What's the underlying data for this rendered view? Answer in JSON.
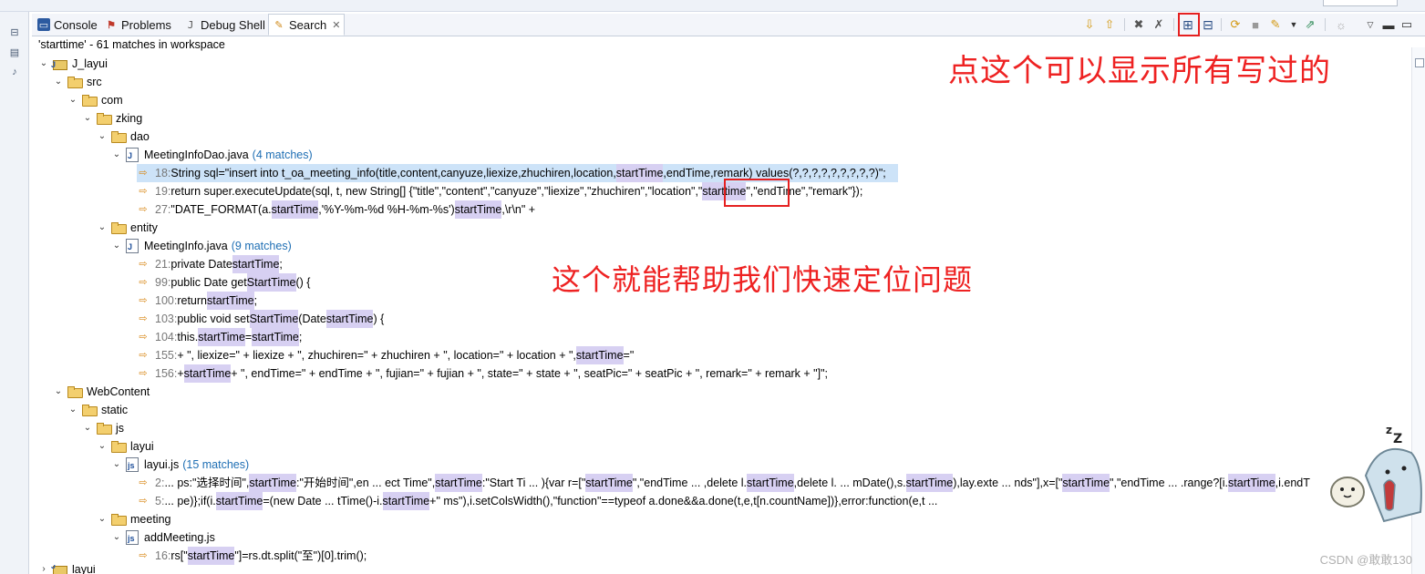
{
  "tabs": [
    {
      "label": "Console",
      "icon": "console-icon"
    },
    {
      "label": "Problems",
      "icon": "problems-icon"
    },
    {
      "label": "Debug Shell",
      "icon": "debug-shell-icon"
    },
    {
      "label": "Search",
      "icon": "search-icon",
      "active": true
    }
  ],
  "header": "'starttime' - 61 matches in workspace",
  "annotations": {
    "expand_hint": "点这个可以显示所有写过的",
    "locate_hint": "这个就能帮助我们快速定位问题"
  },
  "watermark": "CSDN @敢敢130",
  "tree": {
    "project": "J_layui",
    "src": "src",
    "com": "com",
    "zking": "zking",
    "dao": "dao",
    "dao_file": "MeetingInfoDao.java",
    "dao_file_count": "(4 matches)",
    "dao_m1_num": "18:",
    "dao_m1_a": " String sql=\"insert into t_oa_meeting_info(title,content,canyuze,liexize,zhuchiren,location,",
    "dao_m1_hl": "startTime",
    "dao_m1_b": ",endTime,remark) values(?,?,?,?,?,?,?,?,?)\";",
    "dao_m2_num": "19:",
    "dao_m2_a": " return super.executeUpdate(sql, t, new String[] {\"title\",\"content\",\"canyuze\",\"liexize\",\"zhuchiren\",\"location\",\"",
    "dao_m2_hl": "starttime",
    "dao_m2_b": "\",\"endTime\",\"remark\"});",
    "dao_m3_num": "27:",
    "dao_m3_a": " \"DATE_FORMAT(a.",
    "dao_m3_hl1": "startTime",
    "dao_m3_b": ",'%Y-%m-%d %H-%m-%s') ",
    "dao_m3_hl2": "startTime",
    "dao_m3_c": ",\\r\\n\" +",
    "entity": "entity",
    "entity_file": "MeetingInfo.java",
    "entity_file_count": "(9 matches)",
    "e1_num": "21:",
    "e1_a": " private Date ",
    "e1_hl": "startTime",
    "e1_b": ";",
    "e2_num": "99:",
    "e2_a": " public Date get",
    "e2_hl": "StartTime",
    "e2_b": "() {",
    "e3_num": "100:",
    "e3_a": " return ",
    "e3_hl": "startTime",
    "e3_b": ";",
    "e4_num": "103:",
    "e4_a": " public void set",
    "e4_hl1": "StartTime",
    "e4_b": "(Date ",
    "e4_hl2": "startTime",
    "e4_c": ") {",
    "e5_num": "104:",
    "e5_a": " this.",
    "e5_hl1": "startTime",
    "e5_b": " = ",
    "e5_hl2": "startTime",
    "e5_c": ";",
    "e6_num": "155:",
    "e6_a": " + \", liexize=\" + liexize + \", zhuchiren=\" + zhuchiren + \", location=\" + location + \", ",
    "e6_hl": "startTime",
    "e6_b": "=\"",
    "e7_num": "156:",
    "e7_a": " + ",
    "e7_hl": "startTime",
    "e7_b": " + \", endTime=\" + endTime + \", fujian=\" + fujian + \", state=\" + state + \", seatPic=\" + seatPic + \", remark=\" + remark + \"]\";",
    "webcontent": "WebContent",
    "static": "static",
    "js": "js",
    "layui": "layui",
    "layui_file": "layui.js",
    "layui_file_count": "(15 matches)",
    "l1_num": "2:",
    "l1_a": " ... ps:\"选择时间\",",
    "l1_hl1": "startTime",
    "l1_b": ":\"开始时间\",en ... ect Time\",",
    "l1_hl2": "startTime",
    "l1_c": ":\"Start Ti ... ){var r=[\"",
    "l1_hl3": "startTime",
    "l1_d": "\",\"endTime ... ,delete l.",
    "l1_hl4": "startTime",
    "l1_e": ",delete l. ... mDate(),s.",
    "l1_hl5": "startTime",
    "l1_f": "),lay.exte ... nds\"],x=[\"",
    "l1_hl6": "startTime",
    "l1_g": "\",\"endTime ... .range?[i.",
    "l1_hl7": "startTime",
    "l1_h": ",i.endT",
    "l2_num": "5:",
    "l2_a": " ... pe)};if(i.",
    "l2_hl1": "startTime",
    "l2_b": "=(new Date ... tTime()-i.",
    "l2_hl2": "startTime",
    "l2_c": "+\" ms\"),i.setColsWidth(),\"function\"==typeof a.done&&a.done(t,e,t[n.countName])},error:function(e,t ...",
    "meeting": "meeting",
    "meeting_file": "addMeeting.js",
    "m1_num": "16:",
    "m1_a": " rs[\"",
    "m1_hl": "startTime",
    "m1_b": "\"]=rs.dt.split(\"至\")[0].trim();",
    "next_project": "layui"
  }
}
